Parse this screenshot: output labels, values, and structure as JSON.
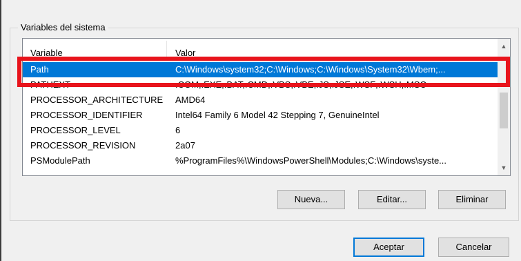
{
  "group": {
    "title": "Variables del sistema"
  },
  "table": {
    "headers": {
      "variable": "Variable",
      "value": "Valor"
    },
    "rows": [
      {
        "name": "Path",
        "value": "C:\\Windows\\system32;C:\\Windows;C:\\Windows\\System32\\Wbem;...",
        "selected": true
      },
      {
        "name": "PATHEXT",
        "value": ".COM;.EXE;.BAT;.CMD;.VBS;.VBE;.JS;.JSE;.WSF;.WSH;.MSC"
      },
      {
        "name": "PROCESSOR_ARCHITECTURE",
        "value": "AMD64"
      },
      {
        "name": "PROCESSOR_IDENTIFIER",
        "value": "Intel64 Family 6 Model 42 Stepping 7, GenuineIntel"
      },
      {
        "name": "PROCESSOR_LEVEL",
        "value": "6"
      },
      {
        "name": "PROCESSOR_REVISION",
        "value": "2a07"
      },
      {
        "name": "PSModulePath",
        "value": "%ProgramFiles%\\WindowsPowerShell\\Modules;C:\\Windows\\syste..."
      }
    ]
  },
  "buttons": {
    "new": "Nueva...",
    "edit": "Editar...",
    "delete": "Eliminar",
    "ok": "Aceptar",
    "cancel": "Cancelar"
  },
  "scrollbar": {
    "up_icon": "chevron-up-icon",
    "down_icon": "chevron-down-icon"
  },
  "colors": {
    "selection": "#0078d7",
    "highlight": "#e8141c"
  }
}
